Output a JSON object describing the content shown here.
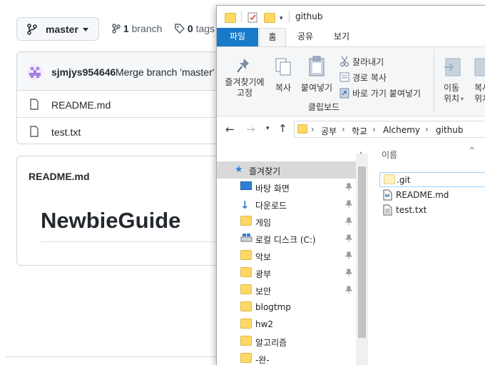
{
  "github": {
    "branch_button": "master",
    "branch_count": "1",
    "branch_label": "branch",
    "tag_count": "0",
    "tag_label": "tags",
    "commit_author": "sjmjys954646",
    "commit_message": "Merge branch 'master'",
    "files": [
      "README.md",
      "test.txt"
    ],
    "readme_title": "README.md",
    "readme_heading": "NewbieGuide"
  },
  "explorer": {
    "title": "github",
    "tabs": [
      "파일",
      "홈",
      "공유",
      "보기"
    ],
    "ribbon": {
      "pin_label_1": "즐겨찾기에",
      "pin_label_2": "고정",
      "copy": "복사",
      "paste": "붙여넣기",
      "cut": "잘라내기",
      "copy_path": "경로 복사",
      "paste_shortcut": "바로 가기 붙여넣기",
      "clipboard_group": "클립보드",
      "move_1": "이동",
      "move_2": "위치",
      "copy_to_1": "복사",
      "copy_to_2": "위치"
    },
    "breadcrumb": [
      "공부",
      "학교",
      "Alchemy",
      "github"
    ],
    "nav": {
      "quick_access": "즐겨찾기",
      "items": [
        "바탕 화면",
        "다운로드",
        "게임",
        "로컬 디스크 (C:)",
        "악보",
        "광부",
        "보안",
        "blogtmp",
        "hw2",
        "알고리즘",
        "-완-"
      ]
    },
    "column_header": "이름",
    "files": [
      ".git",
      "README.md",
      "test.txt"
    ]
  }
}
